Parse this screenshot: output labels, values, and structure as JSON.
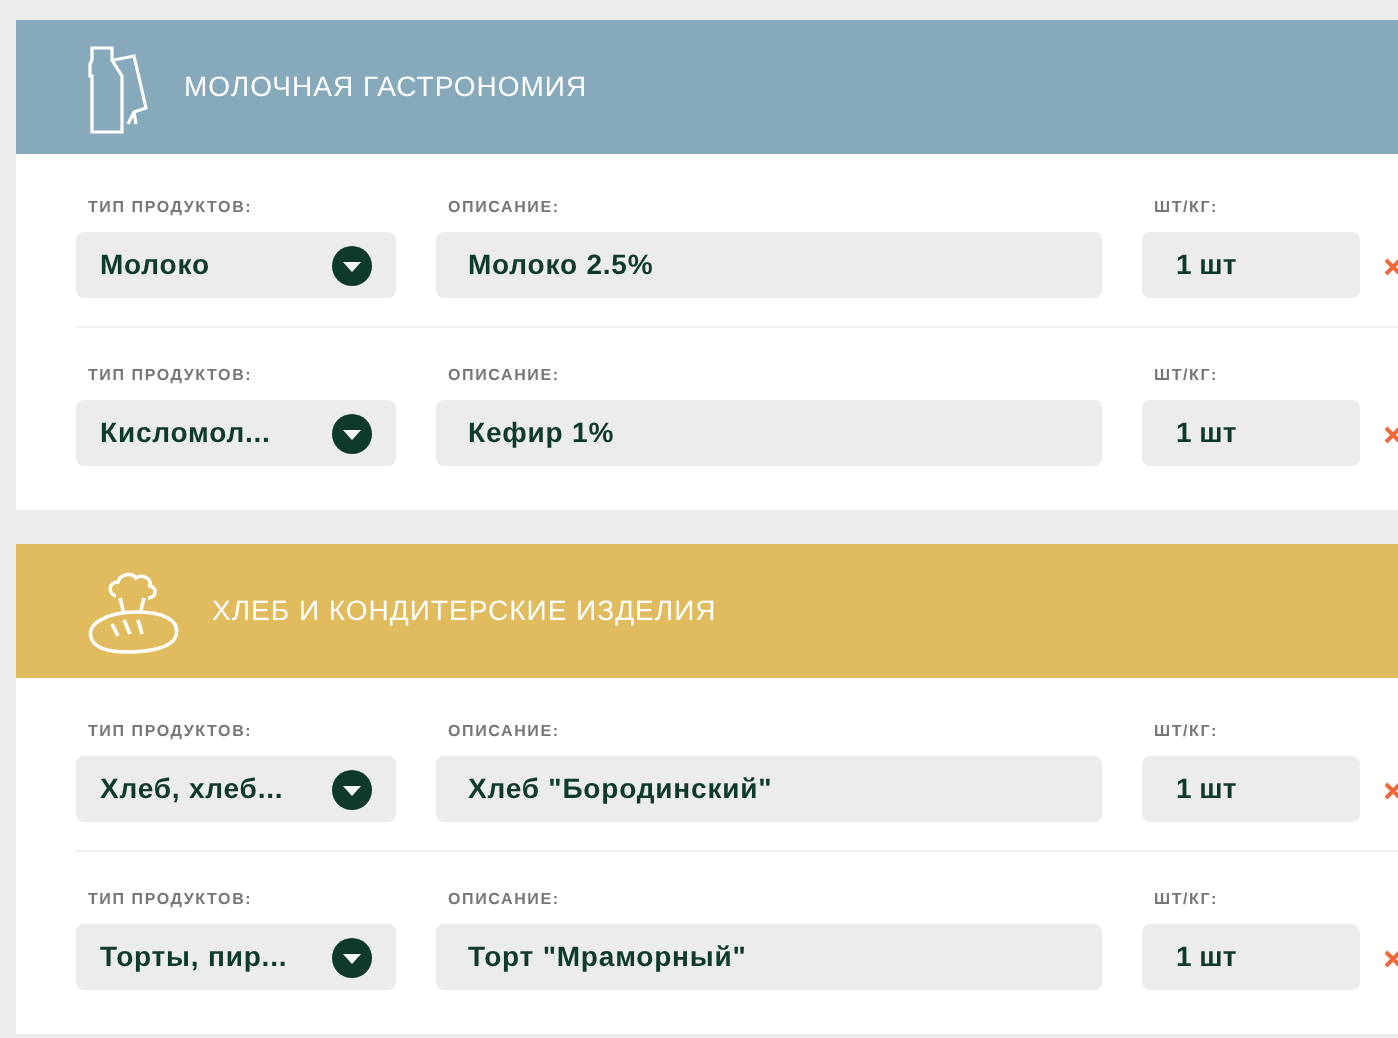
{
  "sections": [
    {
      "kind": "dairy",
      "title": "МОЛОЧНАЯ ГАСТРОНОМИЯ",
      "items": [
        {
          "type_label": "ТИП ПРОДУКТОВ:",
          "type_value": "Молоко",
          "description_label": "ОПИСАНИЕ:",
          "description": "Молоко 2.5%",
          "quantity_label": "ШТ/КГ:",
          "quantity": "1 шт"
        },
        {
          "type_label": "ТИП ПРОДУКТОВ:",
          "type_value": "Кисломол...",
          "description_label": "ОПИСАНИЕ:",
          "description": "Кефир 1%",
          "quantity_label": "ШТ/КГ:",
          "quantity": "1 шт"
        }
      ]
    },
    {
      "kind": "bakery",
      "title": "ХЛЕБ И КОНДИТЕРСКИЕ ИЗДЕЛИЯ",
      "items": [
        {
          "type_label": "ТИП ПРОДУКТОВ:",
          "type_value": "Хлеб, хлеб...",
          "description_label": "ОПИСАНИЕ:",
          "description": "Хлеб \"Бородинский\"",
          "quantity_label": "ШТ/КГ:",
          "quantity": "1 шт"
        },
        {
          "type_label": "ТИП ПРОДУКТОВ:",
          "type_value": "Торты, пир...",
          "description_label": "ОПИСАНИЕ:",
          "description": "Торт \"Мраморный\"",
          "quantity_label": "ШТ/КГ:",
          "quantity": "1 шт"
        }
      ]
    }
  ]
}
